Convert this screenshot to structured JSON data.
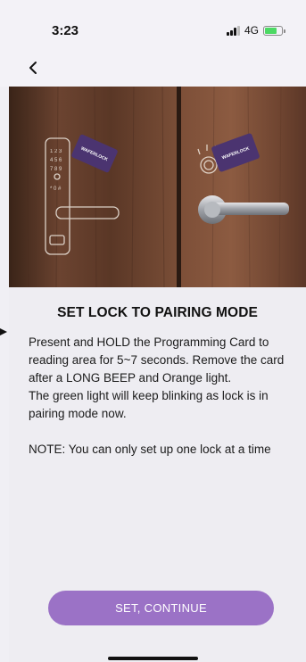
{
  "status_bar": {
    "time": "3:23",
    "network": "4G",
    "icons": [
      "signal-icon",
      "battery-charging-icon"
    ]
  },
  "nav": {
    "back_icon": "chevron-left-icon"
  },
  "hero": {
    "card_brand": "WAFERLOCK",
    "card_color": "#4b3470"
  },
  "content": {
    "title": "SET LOCK TO PAIRING MODE",
    "paragraph1": "Present and HOLD the Programming Card to reading area for 5~7 seconds. Remove the card after a LONG BEEP and Orange light.",
    "paragraph2": "The green light will keep blinking as lock is in pairing mode now.",
    "note": "NOTE: You can only set up one lock at a time"
  },
  "actions": {
    "continue_label": "SET, CONTINUE",
    "accent_color": "#9b72c6"
  }
}
